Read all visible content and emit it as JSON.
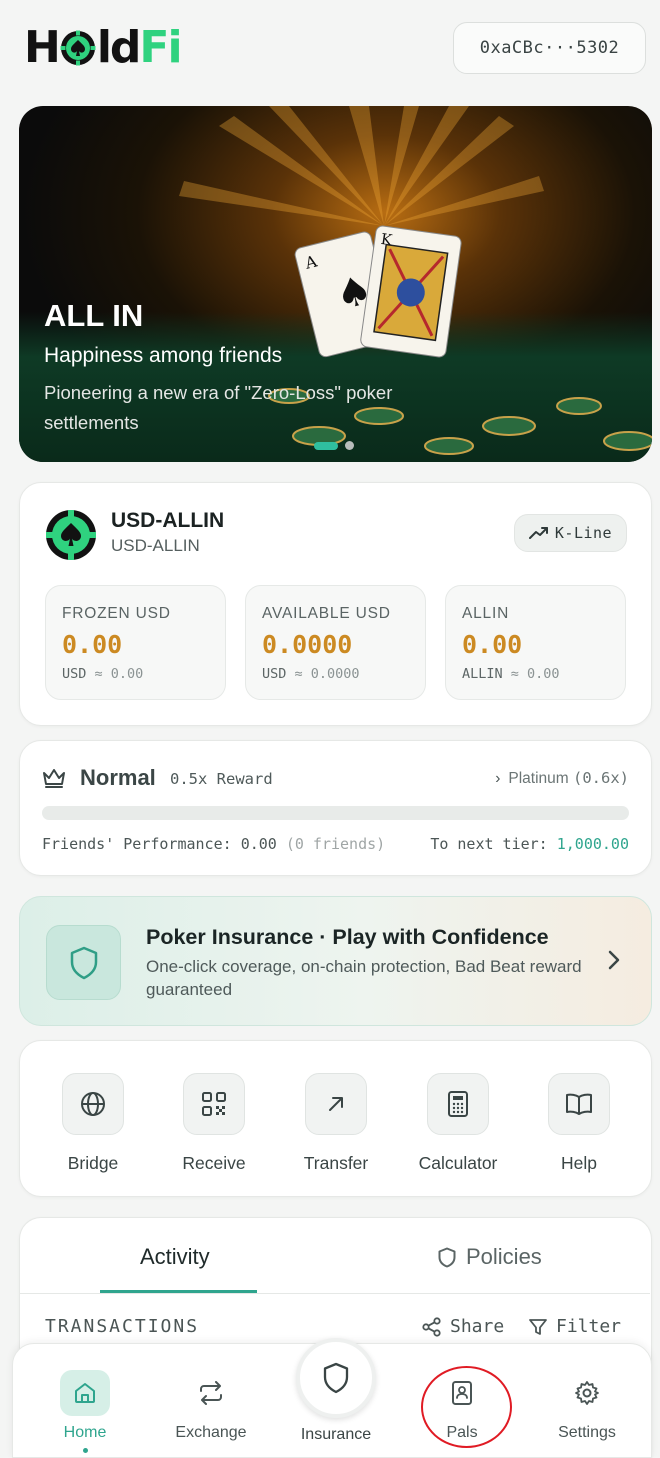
{
  "header": {
    "logo_parts": [
      "H",
      "ld",
      "Fi"
    ],
    "wallet_address": "0xaCBc···5302"
  },
  "banner": {
    "title": "ALL IN",
    "subtitle": "Happiness among friends",
    "description": "Pioneering a new era of \"Zero-Loss\" poker settlements",
    "slide_count": 2,
    "active_slide": 1
  },
  "token": {
    "name": "USD-ALLIN",
    "symbol": "USD-ALLIN",
    "kline_label": "K-Line",
    "balances": [
      {
        "label": "FROZEN USD",
        "value": "0.00",
        "unit": "USD",
        "approx": "≈ 0.00"
      },
      {
        "label": "AVAILABLE USD",
        "value": "0.0000",
        "unit": "USD",
        "approx": "≈ 0.0000"
      },
      {
        "label": "ALLIN",
        "value": "0.00",
        "unit": "ALLIN",
        "approx": "≈ 0.00"
      }
    ]
  },
  "tier": {
    "name": "Normal",
    "reward": "0.5x Reward",
    "next_tier": "Platinum",
    "next_multiplier": "(0.6x)",
    "progress_fraction": 0,
    "performance_label": "Friends' Performance:",
    "performance_value": "0.00",
    "friends_count": "(0 friends)",
    "to_next_label": "To next tier:",
    "to_next_value": "1,000.00"
  },
  "insurance": {
    "title": "Poker Insurance · Play with Confidence",
    "description": "One-click coverage, on-chain protection, Bad Beat reward guaranteed"
  },
  "actions": [
    {
      "label": "Bridge",
      "icon": "globe-icon"
    },
    {
      "label": "Receive",
      "icon": "qr-code-icon"
    },
    {
      "label": "Transfer",
      "icon": "arrow-up-right-icon"
    },
    {
      "label": "Calculator",
      "icon": "calculator-icon"
    },
    {
      "label": "Help",
      "icon": "book-icon"
    }
  ],
  "activity": {
    "tabs": [
      "Activity",
      "Policies"
    ],
    "active_tab": "Activity",
    "section_title": "TRANSACTIONS",
    "share_label": "Share",
    "filter_label": "Filter"
  },
  "bottom_nav": {
    "items": [
      {
        "label": "Home",
        "icon": "home-icon",
        "active": true
      },
      {
        "label": "Exchange",
        "icon": "exchange-icon"
      },
      {
        "label": "Insurance",
        "icon": "shield-icon"
      },
      {
        "label": "Pals",
        "icon": "contact-card-icon"
      },
      {
        "label": "Settings",
        "icon": "gear-icon"
      }
    ]
  },
  "colors": {
    "accent": "#2fbf9f",
    "brand_green": "#2fd27f",
    "balance_gold": "#cc8a22",
    "highlight_ring": "#e01b24"
  }
}
